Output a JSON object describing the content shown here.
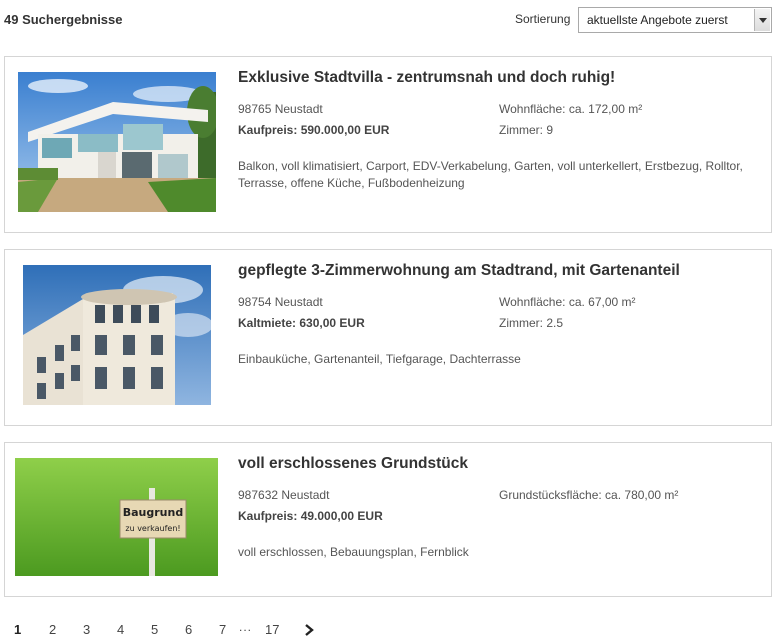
{
  "header": {
    "result_count": "49 Suchergebnisse",
    "sort_label": "Sortierung",
    "sort_value": "aktuellste Angebote zuerst"
  },
  "listings": [
    {
      "title": "Exklusive Stadtvilla - zentrumsnah und doch ruhig!",
      "address": "98765 Neustadt",
      "price_label": "Kaufpreis:",
      "price_value": "590.000,00 EUR",
      "area": "Wohnfläche: ca. 172,00 m²",
      "rooms": "Zimmer: 9",
      "features": "Balkon, voll klimatisiert, Carport, EDV-Verkabelung, Garten, voll unterkellert, Erstbezug, Rolltor, Terrasse, offene Küche, Fußbodenheizung"
    },
    {
      "title": "gepflegte 3-Zimmerwohnung am Stadtrand, mit Gartenanteil",
      "address": "98754 Neustadt",
      "price_label": "Kaltmiete:",
      "price_value": "630,00 EUR",
      "area": "Wohnfläche: ca. 67,00 m²",
      "rooms": "Zimmer: 2.5",
      "features": "Einbauküche, Gartenanteil, Tiefgarage, Dachterrasse"
    },
    {
      "title": "voll erschlossenes Grundstück",
      "address": "987632 Neustadt",
      "price_label": "Kaufpreis:",
      "price_value": "49.000,00 EUR",
      "area": "Grundstücksfläche: ca. 780,00 m²",
      "rooms": "",
      "features": "voll erschlossen, Bebauungsplan, Fernblick",
      "sign_line1": "Baugrund",
      "sign_line2": "zu verkaufen!"
    }
  ],
  "pagination": {
    "pages": [
      "1",
      "2",
      "3",
      "4",
      "5",
      "6",
      "7"
    ],
    "dots": "...",
    "last": "17",
    "current": "1"
  }
}
